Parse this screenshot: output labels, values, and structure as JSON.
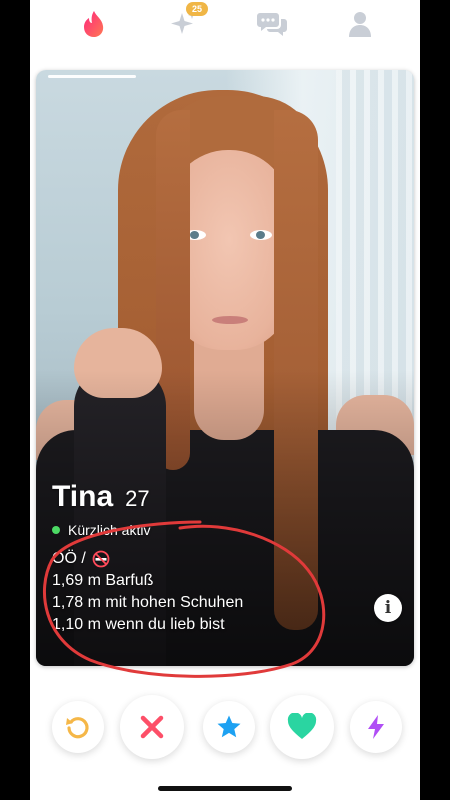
{
  "nav": {
    "items": [
      {
        "icon": "flame-icon",
        "active": true
      },
      {
        "icon": "sparkle-icon",
        "badge": "25"
      },
      {
        "icon": "chat-icon"
      },
      {
        "icon": "profile-icon"
      }
    ],
    "badge_color": "#f0b646",
    "active_color": "#fd267d"
  },
  "profile": {
    "name": "Tina",
    "age": "27",
    "status": "Kürzlich aktiv",
    "status_color": "#4cd964",
    "bio_first": "OÖ /",
    "bio_icon": "no-smoking-icon",
    "bio_lines": [
      "1,69 m Barfuß",
      "1,78 m mit hohen Schuhen",
      "1,10 m wenn du lieb bist"
    ],
    "info_label": "i",
    "photo_count": 1,
    "current_photo": 1
  },
  "actions": [
    {
      "name": "rewind",
      "icon": "rewind-icon",
      "color": "#f5b748"
    },
    {
      "name": "nope",
      "icon": "close-icon",
      "color": "#fd4f68"
    },
    {
      "name": "super-like",
      "icon": "star-icon",
      "color": "#1da1f2"
    },
    {
      "name": "like",
      "icon": "heart-icon",
      "color": "#2ad5a1"
    },
    {
      "name": "boost",
      "icon": "bolt-icon",
      "color": "#b04ef5"
    }
  ],
  "annotation": {
    "shape": "hand-drawn-ellipse",
    "color": "#e03a3a"
  }
}
